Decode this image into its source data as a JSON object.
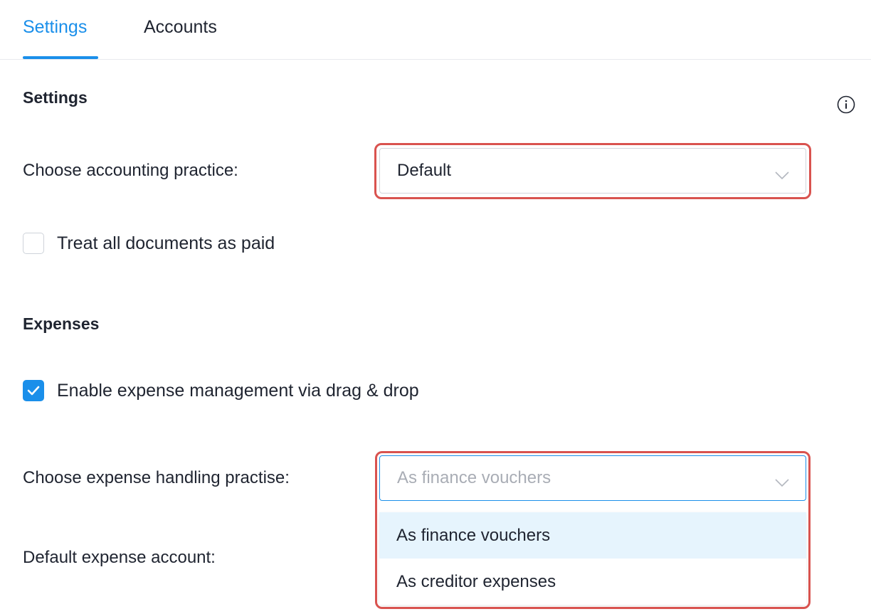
{
  "tabs": {
    "settings": "Settings",
    "accounts": "Accounts"
  },
  "settings_section": {
    "title": "Settings",
    "accounting_practice_label": "Choose accounting practice:",
    "accounting_practice_value": "Default",
    "treat_paid_label": "Treat all documents as paid",
    "treat_paid_checked": false
  },
  "expenses_section": {
    "title": "Expenses",
    "enable_drag_drop_label": "Enable expense management via drag & drop",
    "enable_drag_drop_checked": true,
    "handling_practise_label": "Choose expense handling practise:",
    "handling_practise_placeholder": "As finance vouchers",
    "default_account_label": "Default expense account:",
    "options": [
      "As finance vouchers",
      "As creditor expenses"
    ],
    "active_option": "As finance vouchers"
  },
  "colors": {
    "accent": "#1a8fea",
    "highlight": "#d9534f",
    "option_hover": "#e6f4fd",
    "placeholder": "#a9adb5"
  },
  "icons": {
    "info": "info-icon",
    "chevron": "chevron-down-icon",
    "check": "checkmark-icon"
  }
}
